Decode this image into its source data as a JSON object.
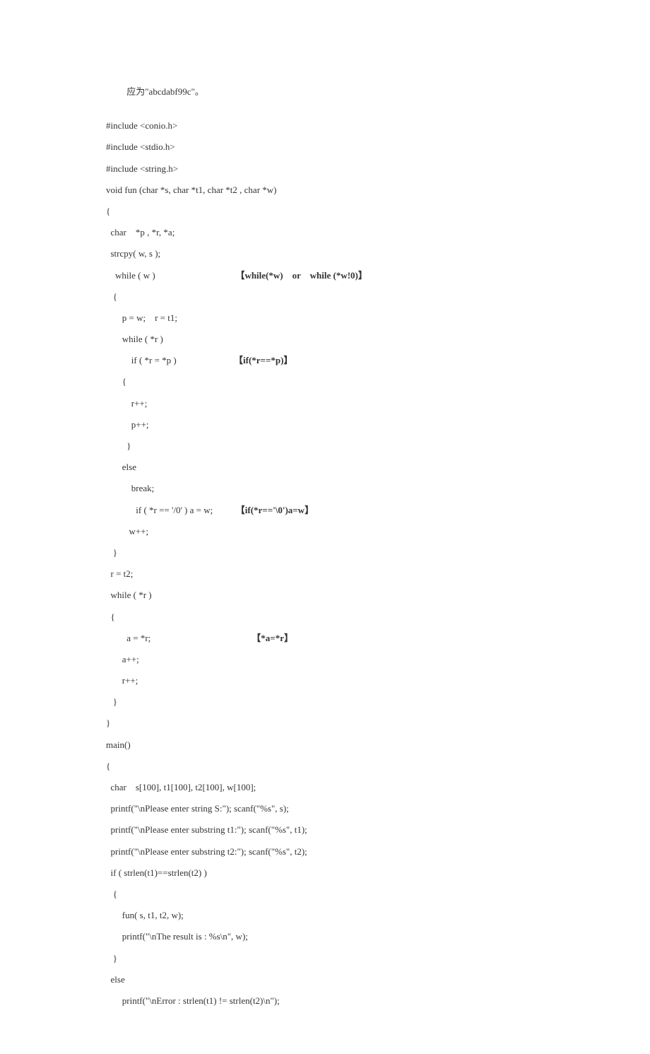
{
  "intro_cn": "         应为\"abcdabf99c\"。",
  "code": {
    "l01": "#include <conio.h>",
    "l02": "#include <stdio.h>",
    "l03": "#include <string.h>",
    "l04": "void fun (char *s, char *t1, char *t2 , char *w)",
    "l05": "{",
    "l06": "  char    *p , *r, *a;",
    "l07": "  strcpy( w, s );",
    "l08": "    while ( w )                                   ",
    "l08a": "【while(*w)    or    while (*w!0)】",
    "l09": "   {",
    "l10": "       p = w;    r = t1;",
    "l11": "       while ( *r )",
    "l12": "           if ( *r = *p )                         ",
    "l12a": "【if(*r==*p)】",
    "l13": "       {",
    "l14": "           r++;",
    "l15": "           p++;",
    "l16": "         }",
    "l17": "       else",
    "l18": "           break;",
    "l19": "             if ( *r == '/0' ) a = w;          ",
    "l19a": "【if(*r=='\\0')a=w】",
    "l20": "          w++;",
    "l21": "   }",
    "l22": "  r = t2;",
    "l23": "  while ( *r )",
    "l24": "  {",
    "l25": "         a = *r;                                            ",
    "l25a": "【*a=*r】",
    "l26": "       a++;",
    "l27": "       r++;",
    "l28": "   }",
    "l29": "}",
    "l30": "main()",
    "l31": "{",
    "l32": "  char    s[100], t1[100], t2[100], w[100];",
    "l33": "  printf(\"\\nPlease enter string S:\"); scanf(\"%s\", s);",
    "l34": "  printf(\"\\nPlease enter substring t1:\"); scanf(\"%s\", t1);",
    "l35": "  printf(\"\\nPlease enter substring t2:\"); scanf(\"%s\", t2);",
    "l36": "  if ( strlen(t1)==strlen(t2) )",
    "l37": "   {",
    "l38": "       fun( s, t1, t2, w);",
    "l39": "       printf(\"\\nThe result is : %s\\n\", w);",
    "l40": "   }",
    "l41": "  else",
    "l42": "       printf(\"\\nError : strlen(t1) != strlen(t2)\\n\");"
  }
}
